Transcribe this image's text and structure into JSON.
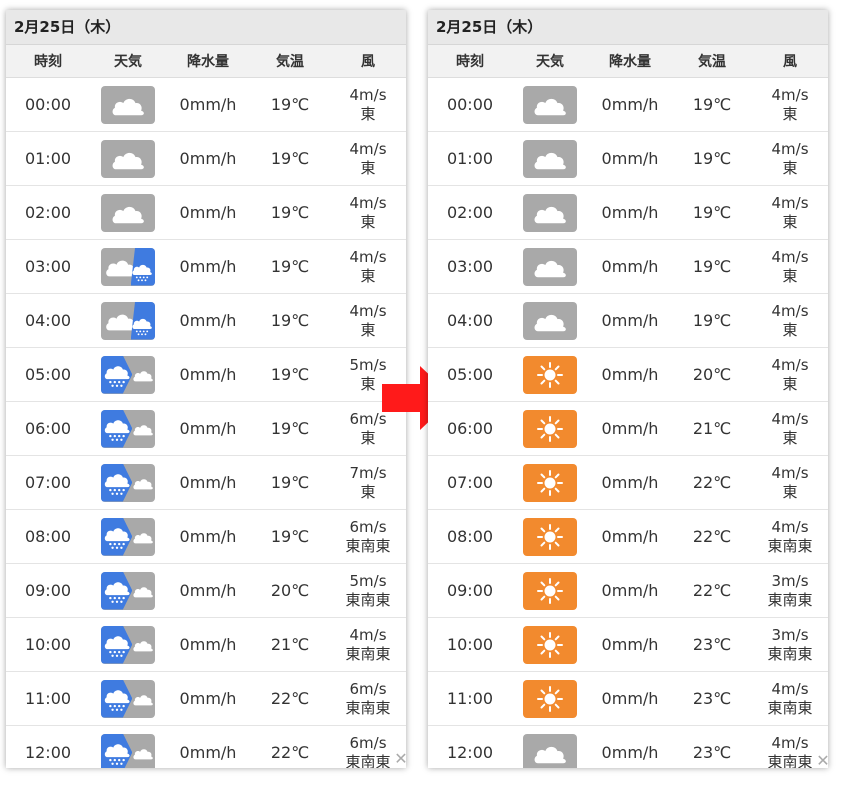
{
  "colors": {
    "cloudy_bg": "#a9a9a9",
    "rain_bg": "#3f7be0",
    "sunny_bg": "#f28a2e",
    "arrow": "#ff1a1a"
  },
  "left": {
    "date": "2月25日（木）",
    "headers": {
      "time": "時刻",
      "weather": "天気",
      "precip": "降水量",
      "temp": "気温",
      "wind": "風"
    },
    "rows": [
      {
        "time": "00:00",
        "icon": "cloudy-icon",
        "precip": "0mm/h",
        "temp": "19℃",
        "wind_speed": "4m/s",
        "wind_dir": "東"
      },
      {
        "time": "01:00",
        "icon": "cloudy-icon",
        "precip": "0mm/h",
        "temp": "19℃",
        "wind_speed": "4m/s",
        "wind_dir": "東"
      },
      {
        "time": "02:00",
        "icon": "cloudy-icon",
        "precip": "0mm/h",
        "temp": "19℃",
        "wind_speed": "4m/s",
        "wind_dir": "東"
      },
      {
        "time": "03:00",
        "icon": "cloudy-then-rain-icon",
        "precip": "0mm/h",
        "temp": "19℃",
        "wind_speed": "4m/s",
        "wind_dir": "東"
      },
      {
        "time": "04:00",
        "icon": "cloudy-then-rain-icon",
        "precip": "0mm/h",
        "temp": "19℃",
        "wind_speed": "4m/s",
        "wind_dir": "東"
      },
      {
        "time": "05:00",
        "icon": "rain-then-cloudy-icon",
        "precip": "0mm/h",
        "temp": "19℃",
        "wind_speed": "5m/s",
        "wind_dir": "東"
      },
      {
        "time": "06:00",
        "icon": "rain-then-cloudy-icon",
        "precip": "0mm/h",
        "temp": "19℃",
        "wind_speed": "6m/s",
        "wind_dir": "東"
      },
      {
        "time": "07:00",
        "icon": "rain-then-cloudy-icon",
        "precip": "0mm/h",
        "temp": "19℃",
        "wind_speed": "7m/s",
        "wind_dir": "東"
      },
      {
        "time": "08:00",
        "icon": "rain-then-cloudy-icon",
        "precip": "0mm/h",
        "temp": "19℃",
        "wind_speed": "6m/s",
        "wind_dir": "東南東"
      },
      {
        "time": "09:00",
        "icon": "rain-then-cloudy-icon",
        "precip": "0mm/h",
        "temp": "20℃",
        "wind_speed": "5m/s",
        "wind_dir": "東南東"
      },
      {
        "time": "10:00",
        "icon": "rain-then-cloudy-icon",
        "precip": "0mm/h",
        "temp": "21℃",
        "wind_speed": "4m/s",
        "wind_dir": "東南東"
      },
      {
        "time": "11:00",
        "icon": "rain-then-cloudy-icon",
        "precip": "0mm/h",
        "temp": "22℃",
        "wind_speed": "6m/s",
        "wind_dir": "東南東"
      },
      {
        "time": "12:00",
        "icon": "rain-then-cloudy-icon",
        "precip": "0mm/h",
        "temp": "22℃",
        "wind_speed": "6m/s",
        "wind_dir": "東南東"
      }
    ],
    "close_glyph": "✕"
  },
  "right": {
    "date": "2月25日（木）",
    "headers": {
      "time": "時刻",
      "weather": "天気",
      "precip": "降水量",
      "temp": "気温",
      "wind": "風"
    },
    "rows": [
      {
        "time": "00:00",
        "icon": "cloudy-icon",
        "precip": "0mm/h",
        "temp": "19℃",
        "wind_speed": "4m/s",
        "wind_dir": "東"
      },
      {
        "time": "01:00",
        "icon": "cloudy-icon",
        "precip": "0mm/h",
        "temp": "19℃",
        "wind_speed": "4m/s",
        "wind_dir": "東"
      },
      {
        "time": "02:00",
        "icon": "cloudy-icon",
        "precip": "0mm/h",
        "temp": "19℃",
        "wind_speed": "4m/s",
        "wind_dir": "東"
      },
      {
        "time": "03:00",
        "icon": "cloudy-icon",
        "precip": "0mm/h",
        "temp": "19℃",
        "wind_speed": "4m/s",
        "wind_dir": "東"
      },
      {
        "time": "04:00",
        "icon": "cloudy-icon",
        "precip": "0mm/h",
        "temp": "19℃",
        "wind_speed": "4m/s",
        "wind_dir": "東"
      },
      {
        "time": "05:00",
        "icon": "sunny-icon",
        "precip": "0mm/h",
        "temp": "20℃",
        "wind_speed": "4m/s",
        "wind_dir": "東"
      },
      {
        "time": "06:00",
        "icon": "sunny-icon",
        "precip": "0mm/h",
        "temp": "21℃",
        "wind_speed": "4m/s",
        "wind_dir": "東"
      },
      {
        "time": "07:00",
        "icon": "sunny-icon",
        "precip": "0mm/h",
        "temp": "22℃",
        "wind_speed": "4m/s",
        "wind_dir": "東"
      },
      {
        "time": "08:00",
        "icon": "sunny-icon",
        "precip": "0mm/h",
        "temp": "22℃",
        "wind_speed": "4m/s",
        "wind_dir": "東南東"
      },
      {
        "time": "09:00",
        "icon": "sunny-icon",
        "precip": "0mm/h",
        "temp": "22℃",
        "wind_speed": "3m/s",
        "wind_dir": "東南東"
      },
      {
        "time": "10:00",
        "icon": "sunny-icon",
        "precip": "0mm/h",
        "temp": "23℃",
        "wind_speed": "3m/s",
        "wind_dir": "東南東"
      },
      {
        "time": "11:00",
        "icon": "sunny-icon",
        "precip": "0mm/h",
        "temp": "23℃",
        "wind_speed": "4m/s",
        "wind_dir": "東南東"
      },
      {
        "time": "12:00",
        "icon": "cloudy-icon",
        "precip": "0mm/h",
        "temp": "23℃",
        "wind_speed": "4m/s",
        "wind_dir": "東南東"
      }
    ],
    "close_glyph": "✕"
  }
}
